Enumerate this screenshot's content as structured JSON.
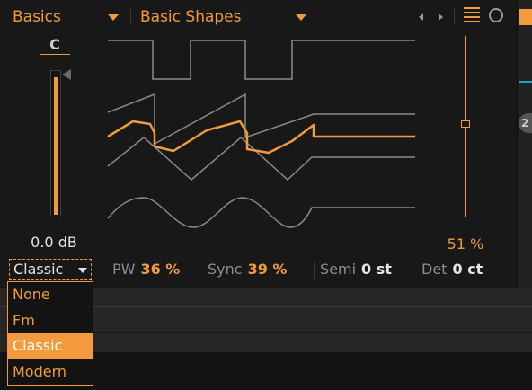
{
  "header": {
    "category": "Basics",
    "preset": "Basic Shapes"
  },
  "key_label": "C",
  "volume": {
    "value_text": "0.0 dB",
    "level": 0.97
  },
  "mode_select": {
    "selected": "Classic"
  },
  "mode_dropdown": {
    "options": [
      "None",
      "Fm",
      "Classic",
      "Modern"
    ],
    "selected_index": 2
  },
  "mix": {
    "value_text": "51 %",
    "level": 0.51
  },
  "params": {
    "pw": {
      "label": "PW",
      "value": "36 %"
    },
    "sync": {
      "label": "Sync",
      "value": "39 %"
    },
    "semi": {
      "label": "Semi",
      "value": "0 st"
    },
    "det": {
      "label": "Det",
      "value": "0 ct"
    }
  },
  "sidebar_badge": "2",
  "colors": {
    "accent": "#f29a3c",
    "panel": "#181818",
    "trace": "#8a8a8a"
  }
}
